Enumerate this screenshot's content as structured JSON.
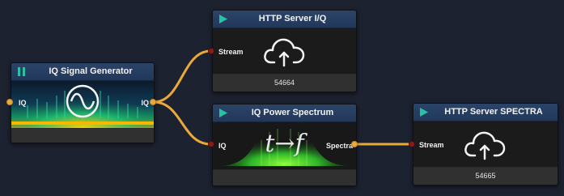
{
  "nodes": {
    "generator": {
      "title": "IQ Signal Generator",
      "control_icon": "pause-icon",
      "in_port": "IQ",
      "out_port": "IQ",
      "status": ""
    },
    "server_iq": {
      "title": "HTTP Server I/Q",
      "control_icon": "play-icon",
      "in_port": "Stream",
      "port_number": "54664"
    },
    "spectrum": {
      "title": "IQ Power Spectrum",
      "control_icon": "play-icon",
      "in_port": "IQ",
      "out_port": "Spectra",
      "status": "",
      "logo_text": "t→f"
    },
    "server_spectra": {
      "title": "HTTP Server SPECTRA",
      "control_icon": "play-icon",
      "in_port": "Stream",
      "port_number": "54665"
    }
  },
  "colors": {
    "canvas_bg": "#1d2230",
    "header": "#22385a",
    "wire": "#e9a93b",
    "play": "#27c4a4",
    "pause": "#27c4a4",
    "input_port": "#8a1c1c",
    "output_port": "#e9a93b"
  },
  "icons": [
    "pause-icon",
    "play-icon",
    "cloud-upload-icon",
    "sine-wave-icon",
    "spectrum-logo"
  ]
}
